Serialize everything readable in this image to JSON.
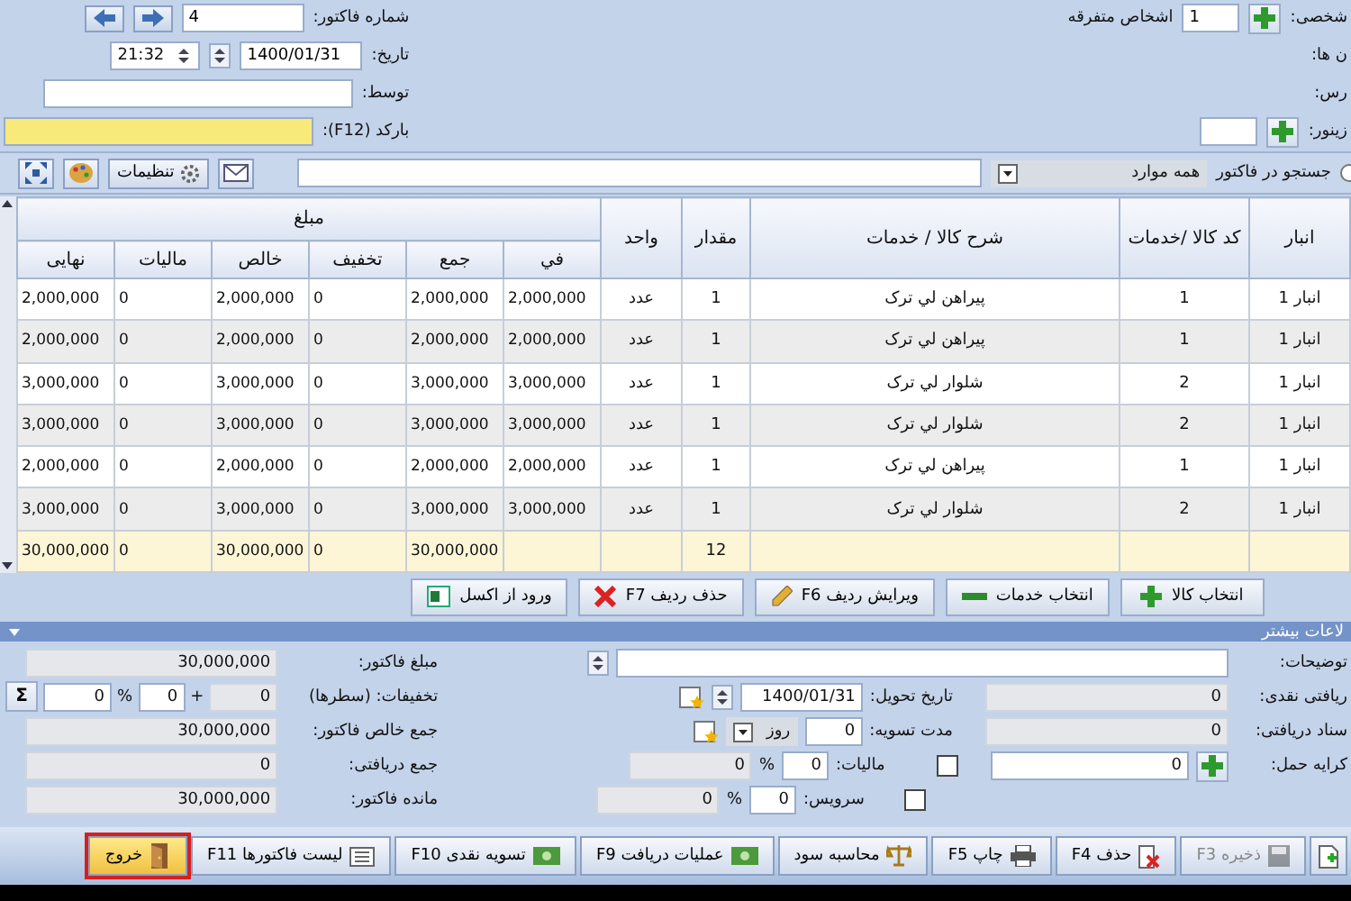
{
  "top_right": [
    {
      "label": "شخصی:",
      "kind": "person",
      "value": "1",
      "text": "اشخاص متفرقه"
    },
    {
      "label": "ن ها:",
      "kind": "plain"
    },
    {
      "label": "رس:",
      "kind": "plain"
    },
    {
      "label": "زینور:",
      "kind": "add"
    }
  ],
  "top_left": [
    {
      "label": "شماره فاکتور:",
      "kind": "nav",
      "value": "4"
    },
    {
      "label": "تاریخ:",
      "kind": "datetime",
      "value": "1400/01/31",
      "time": "21:32"
    },
    {
      "label": "توسط:",
      "kind": "text"
    },
    {
      "label": "بارکد (F12):",
      "kind": "barcode"
    }
  ],
  "toolbar": {
    "search_label": "جستجو در فاکتور",
    "search_selected": false,
    "scope": "همه موارد",
    "settings": "تنظیمات"
  },
  "table": {
    "columns": [
      "انبار",
      "کد کالا /خدمات",
      "شرح کالا / خدمات",
      "مقدار",
      "واحد"
    ],
    "amount_group": "مبلغ",
    "amount_columns": [
      "في",
      "جمع",
      "تخفیف",
      "خالص",
      "مالیات",
      "نهایی"
    ],
    "rows": [
      [
        "انبار 1",
        "1",
        "پیراهن لي ترک",
        "1",
        "عدد",
        "2,000,000",
        "2,000,000",
        "0",
        "2,000,000",
        "0",
        "2,000,000"
      ],
      [
        "انبار 1",
        "1",
        "پیراهن لي ترک",
        "1",
        "عدد",
        "2,000,000",
        "2,000,000",
        "0",
        "2,000,000",
        "0",
        "2,000,000"
      ],
      [
        "انبار 1",
        "2",
        "شلوار لي ترک",
        "1",
        "عدد",
        "3,000,000",
        "3,000,000",
        "0",
        "3,000,000",
        "0",
        "3,000,000"
      ],
      [
        "انبار 1",
        "2",
        "شلوار لي ترک",
        "1",
        "عدد",
        "3,000,000",
        "3,000,000",
        "0",
        "3,000,000",
        "0",
        "3,000,000"
      ],
      [
        "انبار 1",
        "1",
        "پیراهن لي ترک",
        "1",
        "عدد",
        "2,000,000",
        "2,000,000",
        "0",
        "2,000,000",
        "0",
        "2,000,000"
      ],
      [
        "انبار 1",
        "2",
        "شلوار لي ترک",
        "1",
        "عدد",
        "3,000,000",
        "3,000,000",
        "0",
        "3,000,000",
        "0",
        "3,000,000"
      ]
    ],
    "totals": {
      "quantity": "12",
      "sum": "30,000,000",
      "discount": "0",
      "net": "30,000,000",
      "tax": "0",
      "final": "30,000,000"
    }
  },
  "actions": [
    {
      "label": "انتخاب کالا",
      "kind": "plus"
    },
    {
      "label": "انتخاب خدمات",
      "kind": "minus"
    },
    {
      "label": "ویرایش ردیف F6",
      "kind": "pencil"
    },
    {
      "label": "حذف ردیف F7",
      "kind": "cross"
    },
    {
      "label": "ورود از اکسل",
      "kind": "excel"
    }
  ],
  "section": {
    "title": "لاعات بیشتر",
    "expanded": true
  },
  "details": {
    "notes_label": "توضیحات:",
    "cash_label": "ریافتی نقدی:",
    "cash": "0",
    "docs_label": "سناد دریافتی:",
    "docs": "0",
    "freight_label": "کرایه حمل:",
    "freight": "0",
    "delivery_label": "تاریخ تحویل:",
    "delivery": "1400/01/31",
    "settle_label": "مدت تسویه:",
    "settle": "0",
    "settle_unit": "روز",
    "tax": {
      "label": "مالیات:",
      "checked": false,
      "percent": "0",
      "sign": "%",
      "amount": "0"
    },
    "service": {
      "label": "سرویس:",
      "checked": false,
      "percent": "0",
      "sign": "%",
      "amount": "0"
    }
  },
  "summary": {
    "invoice_label": "مبلغ فاکتور:",
    "invoice": "30,000,000",
    "discount_label": "تخفیفات: (سطرها)",
    "discount_rows": "0",
    "plus": "+",
    "discount_value": "0",
    "percent_sign": "%",
    "discount_percent": "0",
    "sigma": "Σ",
    "net_label": "جمع خالص فاکتور:",
    "net": "30,000,000",
    "received_label": "جمع دریافتی:",
    "received": "0",
    "remaining_label": "مانده فاکتور:",
    "remaining": "30,000,000"
  },
  "footer": [
    {
      "kind": "new",
      "disabled": false,
      "focused": false
    },
    {
      "label": "ذخیره F3",
      "kind": "save",
      "disabled": true,
      "focused": false
    },
    {
      "label": "حذف F4",
      "kind": "delete",
      "disabled": false,
      "focused": false
    },
    {
      "label": "چاپ F5",
      "kind": "print",
      "disabled": false,
      "focused": false
    },
    {
      "label": "محاسبه سود",
      "kind": "scale",
      "disabled": false,
      "focused": false
    },
    {
      "label": "عملیات دریافت F9",
      "kind": "money",
      "disabled": false,
      "focused": false
    },
    {
      "label": "تسویه نقدی F10",
      "kind": "money",
      "disabled": false,
      "focused": false
    },
    {
      "label": "لیست فاکتورها F11",
      "kind": "list",
      "disabled": false,
      "focused": false
    },
    {
      "label": "خروج",
      "kind": "exit",
      "disabled": false,
      "focused": true
    }
  ]
}
